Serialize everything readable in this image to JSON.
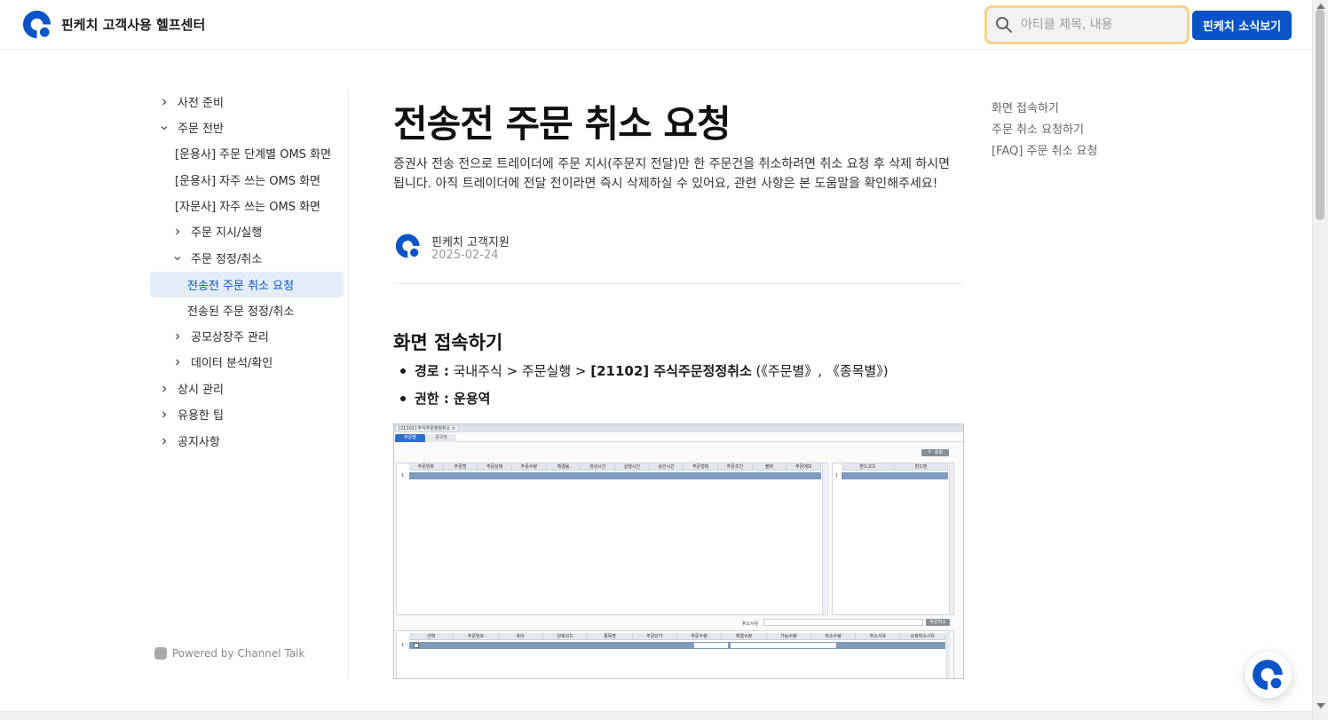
{
  "header": {
    "brand": "핀케치 고객사용 헬프센터",
    "search_placeholder": "아티클 제목, 내용",
    "news_button": "핀케치 소식보기"
  },
  "sidebar": {
    "items": [
      {
        "label": "사전 준비",
        "chevron": "right"
      },
      {
        "label": "주문 전반",
        "chevron": "down"
      },
      {
        "label": "[운용사] 주문 단계별 OMS 화면",
        "chevron": "none"
      },
      {
        "label": "[운용사] 자주 쓰는 OMS 화면",
        "chevron": "none"
      },
      {
        "label": "[자문사] 자주 쓰는 OMS 화면",
        "chevron": "none"
      },
      {
        "label": "주문 지시/실행",
        "chevron": "right"
      },
      {
        "label": "주문 정정/취소",
        "chevron": "down"
      },
      {
        "label": "전송전 주문 취소 요청",
        "chevron": "none",
        "active": true
      },
      {
        "label": "전송된 주문 정정/취소",
        "chevron": "none"
      },
      {
        "label": "공모상장주 관리",
        "chevron": "right"
      },
      {
        "label": "데이터 분석/확인",
        "chevron": "right"
      },
      {
        "label": "상시 관리",
        "chevron": "right"
      },
      {
        "label": "유용한 팁",
        "chevron": "right"
      },
      {
        "label": "공지사항",
        "chevron": "right"
      }
    ],
    "powered_by": "Powered by Channel Talk"
  },
  "article": {
    "title": "전송전 주문 취소 요청",
    "description": "증권사 전송 전으로 트레이더에 주문 지시(주문지 전달)만 한 주문건을 취소하려면 취소 요청 후 삭제 하시면 됩니다. 아직 트레이더에 전달 전이라면 즉시 삭제하실 수 있어요, 관련 사항은 본 도움말을 확인해주세요!",
    "author": "핀케치 고객지원",
    "date": "2025-02-24",
    "section_title": "화면 접속하기",
    "path_label": "경로 :",
    "path_value": "국내주식 > 주문실행 > ",
    "path_screen": "[21102] 주식주문정정취소",
    "path_suffix": " (《주문별》, 《종목별》)",
    "permission_label": "권한 : 운용역"
  },
  "screenshot": {
    "window_tab": "[21102] 주식주문정정취소 ×",
    "tabs": [
      "주문별",
      "종목별"
    ],
    "query_button": "🔍 조회",
    "top_columns": [
      "주문번호",
      "주문명",
      "주문상태",
      "주문수량",
      "체결률",
      "생성시간",
      "실행시간",
      "승인시간",
      "주문형태",
      "주문조건",
      "블락",
      "주문메모"
    ],
    "right_columns": [
      "펀드코드",
      "펀드명"
    ],
    "cancel_reason_label": "취소사유",
    "cancel_button": "주문취소",
    "bottom_columns": [
      "선택",
      "주문번호",
      "B/S",
      "단축코드",
      "종목명",
      "주문단가",
      "주문수량",
      "체결수량",
      "가능수량",
      "취소수량",
      "취소사유",
      "요청취소사유"
    ],
    "row_number": "1"
  },
  "toc": {
    "items": [
      "화면 접속하기",
      "주문 취소 요청하기",
      "[FAQ] 주문 취소 요청"
    ]
  },
  "colors": {
    "brand_blue": "#0a54c8",
    "active_bg": "#e3edfa",
    "search_focus": "#f2d58a"
  }
}
